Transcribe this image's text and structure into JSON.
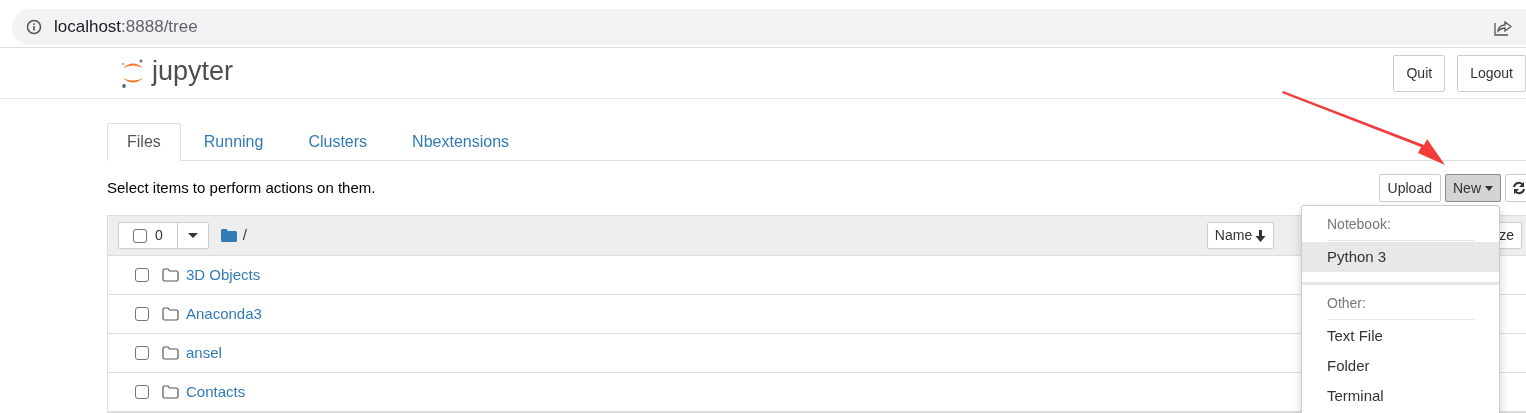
{
  "address_bar": {
    "host": "localhost",
    "rest": ":8888/tree"
  },
  "header": {
    "logo_text": "jupyter",
    "buttons": [
      "Quit",
      "Logout"
    ]
  },
  "tabs": [
    {
      "label": "Files",
      "selected": true
    },
    {
      "label": "Running",
      "selected": false
    },
    {
      "label": "Clusters",
      "selected": false
    },
    {
      "label": "Nbextensions",
      "selected": false
    }
  ],
  "toolbar": {
    "hint": "Select items to perform actions on them.",
    "upload": "Upload",
    "new": "New"
  },
  "list_header": {
    "select_count": "0",
    "checked": false,
    "path": "/",
    "sort_button": "Name",
    "size_button": "ze"
  },
  "rows": [
    {
      "name": "3D Objects",
      "checked": false
    },
    {
      "name": "Anaconda3",
      "checked": false
    },
    {
      "name": "ansel",
      "checked": false
    },
    {
      "name": "Contacts",
      "checked": false
    }
  ],
  "new_menu": {
    "sections": [
      {
        "heading": "Notebook:",
        "items": [
          {
            "label": "Python 3",
            "selected": true
          }
        ]
      },
      {
        "heading": "Other:",
        "items": [
          {
            "label": "Text File",
            "selected": false
          },
          {
            "label": "Folder",
            "selected": false
          },
          {
            "label": "Terminal",
            "selected": false
          }
        ]
      }
    ]
  }
}
